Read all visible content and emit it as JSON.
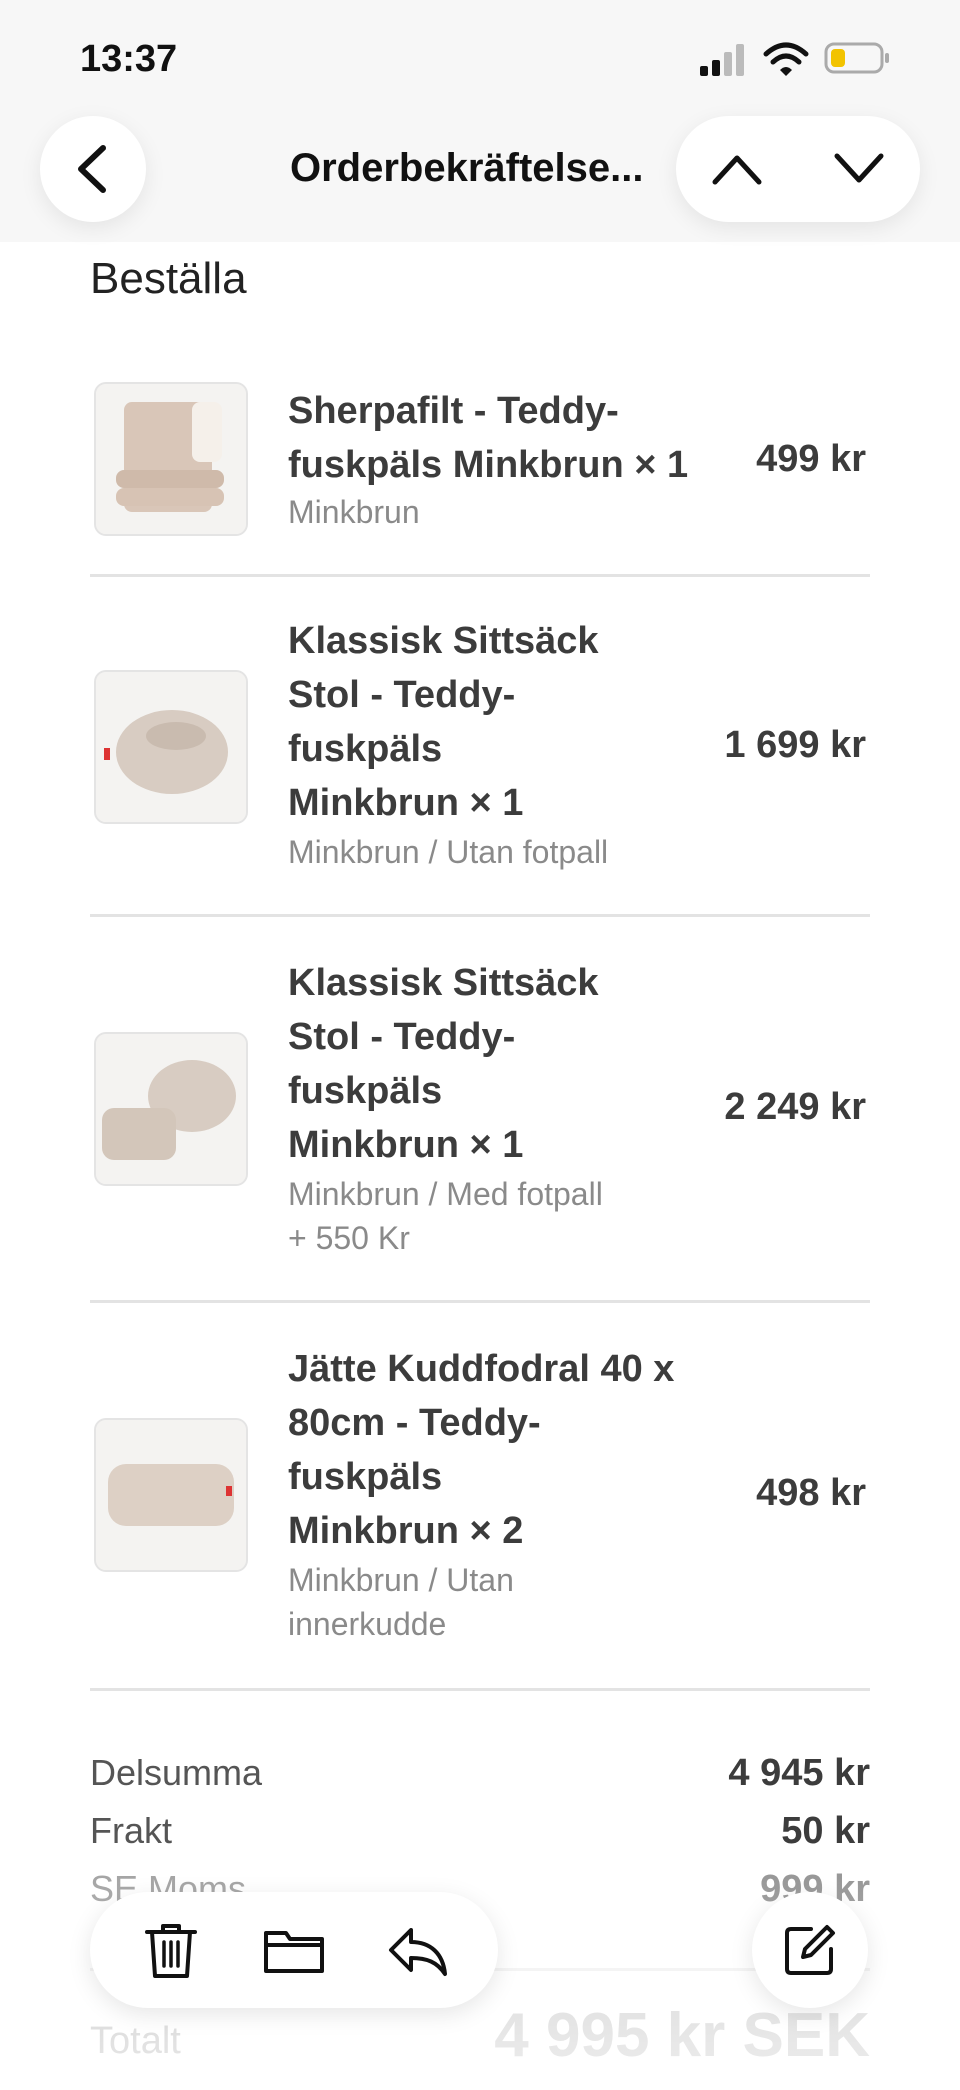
{
  "status_bar": {
    "time": "13:37",
    "icons": [
      "cellular-signal-icon",
      "wifi-icon",
      "battery-low-icon"
    ]
  },
  "nav": {
    "title": "Orderbekräftelse...",
    "back_icon": "chevron-left-icon",
    "prev_icon": "chevron-up-icon",
    "next_icon": "chevron-down-icon"
  },
  "order": {
    "section_title": "Beställa",
    "items": [
      {
        "name_lines": [
          "Sherpafilt - Teddy-",
          "fuskpäls Minkbrun × 1"
        ],
        "variant_lines": [
          "Minkbrun"
        ],
        "price": "499 kr",
        "thumb": "folded-blanket-image"
      },
      {
        "name_lines": [
          "Klassisk Sittsäck",
          "Stol - Teddy-",
          "fuskpäls",
          "Minkbrun × 1"
        ],
        "variant_lines": [
          "Minkbrun / Utan fotpall"
        ],
        "price": "1 699 kr",
        "thumb": "beanbag-chair-image"
      },
      {
        "name_lines": [
          "Klassisk Sittsäck",
          "Stol - Teddy-",
          "fuskpäls",
          "Minkbrun × 1"
        ],
        "variant_lines": [
          "Minkbrun / Med fotpall",
          "+ 550 Kr"
        ],
        "price": "2 249 kr",
        "thumb": "beanbag-with-footstool-image"
      },
      {
        "name_lines": [
          "Jätte Kuddfodral 40 x",
          "80cm - Teddy-",
          "fuskpäls",
          "Minkbrun × 2"
        ],
        "variant_lines": [
          "Minkbrun / Utan",
          "innerkudde"
        ],
        "price": "498 kr",
        "thumb": "long-cushion-image"
      }
    ]
  },
  "summary": {
    "subtotal_label": "Delsumma",
    "subtotal_value": "4 945 kr",
    "shipping_label": "Frakt",
    "shipping_value": "50 kr",
    "vat_label": "SE Moms",
    "vat_value": "999 kr",
    "total_label": "Totalt",
    "total_value": "4 995 kr SEK"
  },
  "toolbar": {
    "icons": [
      "trash-icon",
      "folder-icon",
      "reply-icon",
      "compose-icon"
    ]
  }
}
